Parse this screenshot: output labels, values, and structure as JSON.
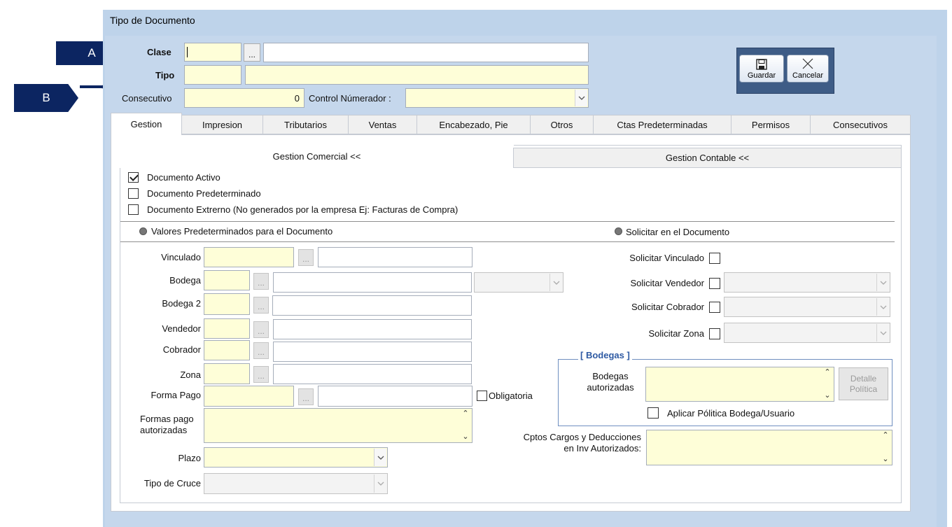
{
  "window": {
    "title": "Tipo de Documento"
  },
  "callouts": {
    "a": "A",
    "b": "B"
  },
  "header": {
    "clase_label": "Clase",
    "tipo_label": "Tipo",
    "consecutivo_label": "Consecutivo",
    "consecutivo_value": "0",
    "control_numerador_label": "Control Númerador :",
    "ellipsis": "..."
  },
  "toolbar": {
    "save_label": "Guardar",
    "cancel_label": "Cancelar"
  },
  "tabs": [
    {
      "label": "Gestion"
    },
    {
      "label": "Impresion"
    },
    {
      "label": "Tributarios"
    },
    {
      "label": "Ventas"
    },
    {
      "label": "Encabezado, Pie"
    },
    {
      "label": "Otros"
    },
    {
      "label": "Ctas Predeterminadas"
    },
    {
      "label": "Permisos"
    },
    {
      "label": "Consecutivos"
    }
  ],
  "subtabs": {
    "comercial": "Gestion Comercial <<",
    "contable": "Gestion Contable <<"
  },
  "checks": {
    "activo": "Documento Activo",
    "predeterminado": "Documento Predeterminado",
    "externo": "Documento Extrerno (No generados por la empresa  Ej: Facturas de Compra)"
  },
  "sections": {
    "valores": "Valores Predeterminados para el Documento",
    "solicitar": "Solicitar en el Documento"
  },
  "left_fields": {
    "vinculado": "Vinculado",
    "bodega": "Bodega",
    "bodega2": "Bodega 2",
    "vendedor": "Vendedor",
    "cobrador": "Cobrador",
    "zona": "Zona",
    "forma_pago": "Forma Pago",
    "obligatoria": "Obligatoria",
    "formas_pago_1": "Formas pago",
    "formas_pago_2": "autorizadas",
    "plazo": "Plazo",
    "tipo_cruce": "Tipo de Cruce",
    "dots": "..."
  },
  "right_fields": {
    "solicitar_vinculado": "Solicitar Vinculado",
    "solicitar_vendedor": "Solicitar Vendedor",
    "solicitar_cobrador": "Solicitar Cobrador",
    "solicitar_zona": "Solicitar Zona",
    "bodegas_group": "[ Bodegas ]",
    "bodegas_autorizadas_1": "Bodegas",
    "bodegas_autorizadas_2": "autorizadas",
    "detalle_1": "Detalle",
    "detalle_2": "Política",
    "aplicar_politica": "Aplicar Pólitica Bodega/Usuario",
    "cptos_1": "Cptos Cargos y Deducciones",
    "cptos_2": "en Inv Autorizados:"
  },
  "colors": {
    "accent": "#0c2561",
    "field": "#fefed8",
    "window": "#bed3ea"
  }
}
